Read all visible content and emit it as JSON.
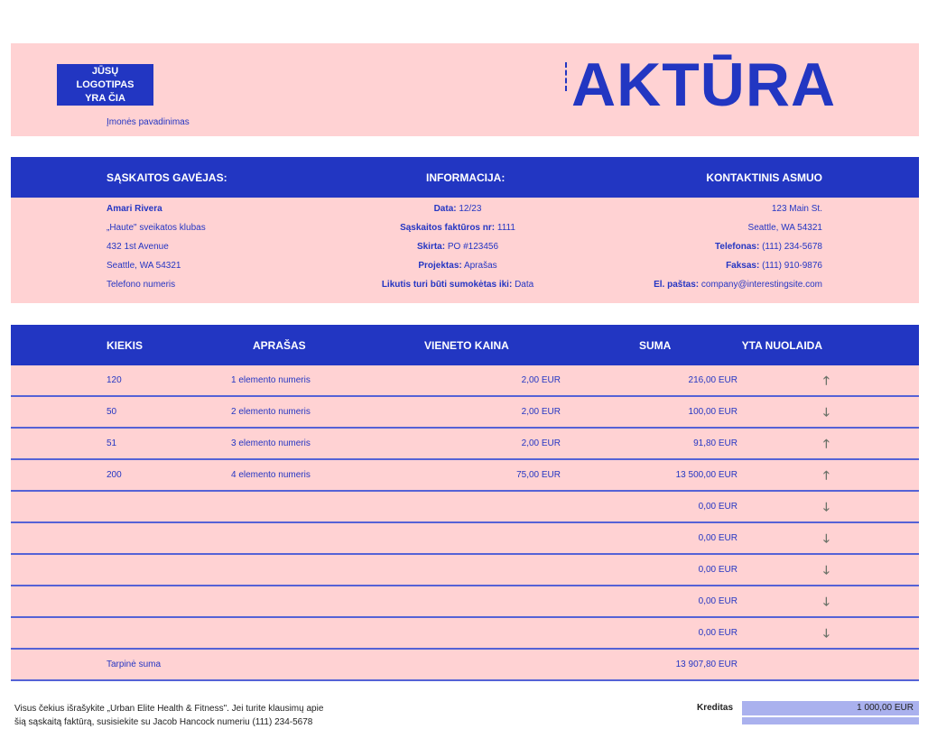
{
  "header": {
    "logo_line1": "JŪSŲ LOGOTIPAS",
    "logo_line2": "YRA ČIA",
    "company_name": "Įmonės pavadinimas",
    "title": "AKTŪRA"
  },
  "info_headers": {
    "recipient": "SĄSKAITOS GAVĖJAS:",
    "information": "INFORMACIJA:",
    "contact": "KONTAKTINIS ASMUO"
  },
  "recipient": {
    "name": "Amari Rivera",
    "club": "„Haute\" sveikatos klubas",
    "street": "432 1st Avenue",
    "city": "Seattle, WA 54321",
    "phone": "Telefono numeris"
  },
  "information": [
    {
      "label": "Data:",
      "value": "12/23"
    },
    {
      "label": "Sąskaitos faktūros nr:",
      "value": "1111"
    },
    {
      "label": "Skirta:",
      "value": "PO #123456"
    },
    {
      "label": "Projektas:",
      "value": "Aprašas"
    },
    {
      "label": "Likutis turi būti sumokėtas iki:",
      "value": "Data"
    }
  ],
  "contact": {
    "street": "123 Main St.",
    "city": "Seattle, WA 54321",
    "phone_label": "Telefonas:",
    "phone": "(111) 234-5678",
    "fax_label": "Faksas:",
    "fax": "(111) 910-9876",
    "email_label": "El. paštas:",
    "email": "company@interestingsite.com"
  },
  "table": {
    "headers": [
      "KIEKIS",
      "APRAŠAS",
      "VIENETO KAINA",
      "SUMA",
      "YTA NUOLAIDA"
    ],
    "rows": [
      {
        "qty": "120",
        "desc": "1 elemento numeris",
        "price": "2,00 EUR",
        "total": "216,00 EUR",
        "arrow": "up"
      },
      {
        "qty": "50",
        "desc": "2 elemento numeris",
        "price": "2,00 EUR",
        "total": "100,00 EUR",
        "arrow": "down"
      },
      {
        "qty": "51",
        "desc": "3 elemento numeris",
        "price": "2,00 EUR",
        "total": "91,80 EUR",
        "arrow": "up"
      },
      {
        "qty": "200",
        "desc": "4 elemento numeris",
        "price": "75,00 EUR",
        "total": "13 500,00 EUR",
        "arrow": "up"
      },
      {
        "qty": "",
        "desc": "",
        "price": "",
        "total": "0,00 EUR",
        "arrow": "down"
      },
      {
        "qty": "",
        "desc": "",
        "price": "",
        "total": "0,00 EUR",
        "arrow": "down"
      },
      {
        "qty": "",
        "desc": "",
        "price": "",
        "total": "0,00 EUR",
        "arrow": "down"
      },
      {
        "qty": "",
        "desc": "",
        "price": "",
        "total": "0,00 EUR",
        "arrow": "down"
      },
      {
        "qty": "",
        "desc": "",
        "price": "",
        "total": "0,00 EUR",
        "arrow": "down"
      }
    ],
    "subtotal_label": "Tarpinė suma",
    "subtotal": "13 907,80 EUR"
  },
  "footer": {
    "note_line1": "Visus čekius išrašykite „Urban Elite Health & Fitness\". Jei turite klausimų apie",
    "note_line2": "šią sąskaitą faktūrą, susisiekite su Jacob Hancock numeriu (111) 234-5678",
    "credit_label": "Kreditas",
    "credit_value": "1 000,00 EUR"
  },
  "arrows": {
    "up": "🡑",
    "down": "🡓"
  }
}
